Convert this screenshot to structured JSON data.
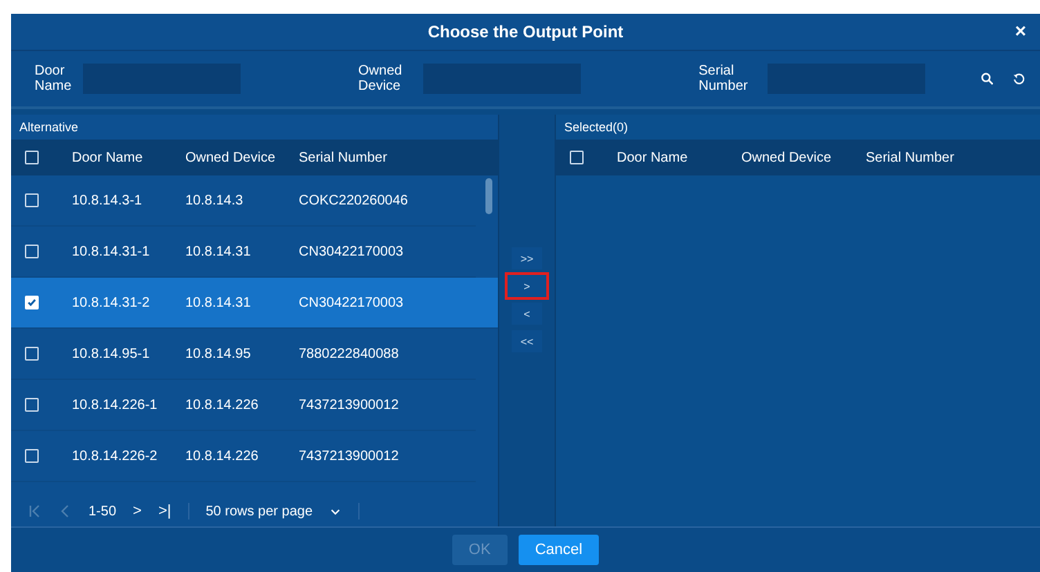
{
  "window": {
    "title": "Choose the Output Point",
    "close": "×"
  },
  "filters": [
    {
      "label": "Door Name"
    },
    {
      "label": "Owned Device"
    },
    {
      "label": "Serial Number"
    }
  ],
  "alternative": {
    "title": "Alternative",
    "header_checked": false,
    "columns": [
      "Door Name",
      "Owned Device",
      "Serial Number"
    ],
    "rows": [
      {
        "door": "10.8.14.3-1",
        "device": "10.8.14.3",
        "serial": "COKC220260046",
        "selected": false
      },
      {
        "door": "10.8.14.31-1",
        "device": "10.8.14.31",
        "serial": "CN30422170003",
        "selected": false
      },
      {
        "door": "10.8.14.31-2",
        "device": "10.8.14.31",
        "serial": "CN30422170003",
        "selected": true
      },
      {
        "door": "10.8.14.95-1",
        "device": "10.8.14.95",
        "serial": "7880222840088",
        "selected": false
      },
      {
        "door": "10.8.14.226-1",
        "device": "10.8.14.226",
        "serial": "7437213900012",
        "selected": false
      },
      {
        "door": "10.8.14.226-2",
        "device": "10.8.14.226",
        "serial": "7437213900012",
        "selected": false
      }
    ],
    "pager": {
      "range": "1-50",
      "next": ">",
      "last": ">|",
      "page_size": "50 rows per page"
    }
  },
  "transfer": [
    {
      "label": ">>",
      "highlighted": false
    },
    {
      "label": ">",
      "highlighted": true
    },
    {
      "label": "<",
      "highlighted": false
    },
    {
      "label": "<<",
      "highlighted": false
    }
  ],
  "selected_panel": {
    "title": "Selected(0)",
    "header_checked": false,
    "columns": [
      "Door Name",
      "Owned Device",
      "Serial Number"
    ]
  },
  "buttons": [
    {
      "label": "OK",
      "disabled": true
    },
    {
      "label": "Cancel",
      "disabled": false
    }
  ]
}
